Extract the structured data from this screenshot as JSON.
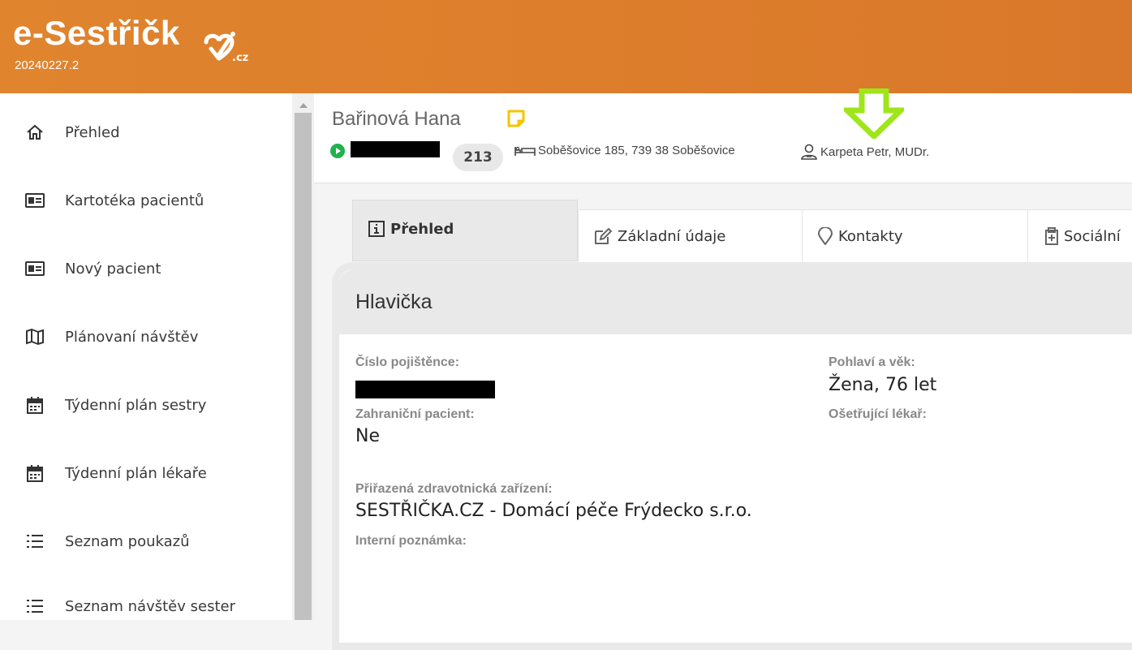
{
  "app": {
    "logo_text": "e-Sestřičk",
    "logo_tld": ".cz",
    "version": "20240227.2",
    "brand_color": "#e0842e"
  },
  "sidebar": {
    "items": [
      {
        "label": "Přehled",
        "icon": "home-icon"
      },
      {
        "label": "Kartotéka pacientů",
        "icon": "id-card-icon"
      },
      {
        "label": "Nový pacient",
        "icon": "id-card-icon"
      },
      {
        "label": "Plánovaní návštěv",
        "icon": "map-icon"
      },
      {
        "label": "Týdenní plán sestry",
        "icon": "calendar-icon"
      },
      {
        "label": "Týdenní plán lékaře",
        "icon": "calendar-icon"
      },
      {
        "label": "Seznam poukazů",
        "icon": "list-icon"
      },
      {
        "label": "Seznam návštěv sester",
        "icon": "list-icon"
      }
    ]
  },
  "patient": {
    "name": "Bařinová Hana",
    "room": "213",
    "address": "Soběšovice 185, 739 38 Soběšovice",
    "doctor": "Karpeta Petr, MUDr.",
    "status_color": "#22b14c"
  },
  "tabs": [
    {
      "label": "Přehled",
      "icon": "info-icon",
      "active": true
    },
    {
      "label": "Základní údaje",
      "icon": "edit-icon",
      "active": false
    },
    {
      "label": "Kontakty",
      "icon": "location-pin-icon",
      "active": false
    },
    {
      "label": "Sociální",
      "icon": "clipboard-icon",
      "active": false
    }
  ],
  "card": {
    "title": "Hlavička",
    "insurance_label": "Číslo pojištěnce:",
    "foreign_label": "Zahraniční pacient:",
    "foreign_value": "Ne",
    "gender_age_label": "Pohlaví a věk:",
    "gender_age_value": "Žena, 76 let",
    "doctor_label": "Ošetřující lékař:",
    "facilities_label": "Přiřazená zdravotnická zařízení:",
    "facilities_value": "SESTŘIČKA.CZ - Domácí péče Frýdecko s.r.o.",
    "note_label": "Interní poznámka:"
  },
  "annotation": {
    "arrow_color": "#9ee61a"
  }
}
